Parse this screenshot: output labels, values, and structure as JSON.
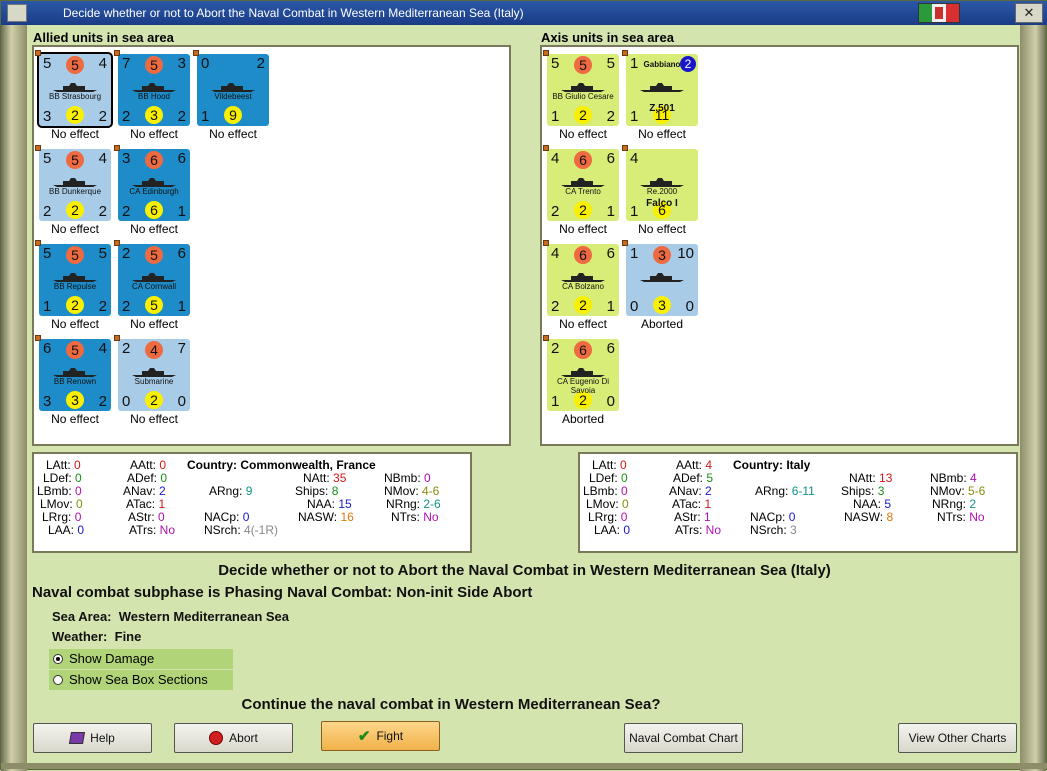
{
  "window": {
    "title": "Decide whether or not to Abort the Naval Combat in Western Mediterranean Sea (Italy)"
  },
  "allied": {
    "heading": "Allied units in sea area",
    "units": [
      {
        "tl": "5",
        "tc": "5",
        "tr": "4",
        "name": "BB Strasbourg",
        "bl": "3",
        "bc": "2",
        "br": "2",
        "status": "No effect",
        "color": "#a8cce8"
      },
      {
        "tl": "7",
        "tc": "5",
        "tr": "3",
        "name": "BB Hood",
        "bl": "2",
        "bc": "3",
        "br": "2",
        "status": "No effect",
        "color": "#1e8cc8"
      },
      {
        "tl": "0",
        "tc": "",
        "tr": "2",
        "name": "Vildebeest",
        "bl": "1",
        "bc": "9",
        "br": "",
        "status": "No effect",
        "color": "#1e8cc8"
      },
      {
        "tl": "5",
        "tc": "5",
        "tr": "4",
        "name": "BB Dunkerque",
        "bl": "2",
        "bc": "2",
        "br": "2",
        "status": "No effect",
        "color": "#a8cce8"
      },
      {
        "tl": "3",
        "tc": "6",
        "tr": "6",
        "name": "CA Edinburgh",
        "bl": "2",
        "bc": "6",
        "br": "1",
        "status": "No effect",
        "color": "#1e8cc8"
      },
      {
        "tl": "5",
        "tc": "5",
        "tr": "5",
        "name": "BB Repulse",
        "bl": "1",
        "bc": "2",
        "br": "2",
        "status": "No effect",
        "color": "#1e8cc8"
      },
      {
        "tl": "2",
        "tc": "5",
        "tr": "6",
        "name": "CA Cornwall",
        "bl": "2",
        "bc": "5",
        "br": "1",
        "status": "No effect",
        "color": "#1e8cc8"
      },
      {
        "tl": "6",
        "tc": "5",
        "tr": "4",
        "name": "BB Renown",
        "bl": "3",
        "bc": "3",
        "br": "2",
        "status": "No effect",
        "color": "#1e8cc8"
      },
      {
        "tl": "2",
        "tc": "4",
        "tr": "7",
        "name": "Submarine",
        "bl": "0",
        "bc": "2",
        "br": "0",
        "status": "No effect",
        "color": "#a8cce8"
      }
    ]
  },
  "axis": {
    "heading": "Axis units in sea area",
    "units": [
      {
        "tl": "5",
        "tc": "5",
        "tr": "5",
        "name": "BB Giulio Cesare",
        "bl": "1",
        "bc": "2",
        "br": "2",
        "status": "No effect",
        "color": "#d8ec78"
      },
      {
        "tl": "1",
        "tc": "",
        "tr": "",
        "name": "Gabbiano",
        "badge": "2",
        "bl": "1",
        "bc": "11",
        "br": "",
        "sub": "Z.501",
        "status": "No effect",
        "color": "#d8ec78"
      },
      {
        "tl": "4",
        "tc": "6",
        "tr": "6",
        "name": "CA Trento",
        "bl": "2",
        "bc": "2",
        "br": "1",
        "status": "No effect",
        "color": "#d8ec78"
      },
      {
        "tl": "4",
        "tc": "",
        "tr": "",
        "name": "Re.2000",
        "sub": "Falco I",
        "bl": "1",
        "bc": "6",
        "br": "",
        "status": "No effect",
        "color": "#d8ec78"
      },
      {
        "tl": "4",
        "tc": "6",
        "tr": "6",
        "name": "CA Bolzano",
        "bl": "2",
        "bc": "2",
        "br": "1",
        "status": "No effect",
        "color": "#d8ec78"
      },
      {
        "tl": "1",
        "tc": "3",
        "tr": "10",
        "name": "",
        "bl": "0",
        "bc": "3",
        "br": "0",
        "status": "Aborted",
        "color": "#a8cce8"
      },
      {
        "tl": "2",
        "tc": "6",
        "tr": "6",
        "name": "CA Eugenio Di Savoia",
        "bl": "1",
        "bc": "2",
        "br": "0",
        "status": "Aborted",
        "color": "#d8ec78"
      }
    ]
  },
  "allied_stats": {
    "country_label": "Country:",
    "country": "Commonwealth, France",
    "LAtt": "0",
    "LDef": "0",
    "LBmb": "0",
    "LMov": "0",
    "LRrg": "0",
    "LAA": "0",
    "AAtt": "0",
    "ADef": "0",
    "ANav": "2",
    "ATac": "1",
    "AStr": "0",
    "ATrs": "No",
    "ARng": "9",
    "NACp": "0",
    "NSrch": "4(-1R)",
    "NAtt": "35",
    "Ships": "8",
    "NAA": "15",
    "NASW": "16",
    "NBmb": "0",
    "NMov": "4-6",
    "NRng": "2-6",
    "NTrs": "No"
  },
  "axis_stats": {
    "country_label": "Country:",
    "country": "Italy",
    "LAtt": "0",
    "LDef": "0",
    "LBmb": "0",
    "LMov": "0",
    "LRrg": "0",
    "LAA": "0",
    "AAtt": "4",
    "ADef": "5",
    "ANav": "2",
    "ATac": "1",
    "AStr": "1",
    "ATrs": "No",
    "ARng": "6-11",
    "NACp": "0",
    "NSrch": "3",
    "NAtt": "13",
    "Ships": "3",
    "NAA": "5",
    "NASW": "8",
    "NBmb": "4",
    "NMov": "5-6",
    "NRng": "2",
    "NTrs": "No"
  },
  "main": {
    "heading": "Decide whether or not to Abort the Naval Combat in Western Mediterranean Sea (Italy)",
    "subphase": "Naval combat subphase is Phasing Naval Combat: Non-init Side Abort",
    "sea_area_label": "Sea Area:",
    "sea_area": "Western Mediterranean Sea",
    "weather_label": "Weather:",
    "weather": "Fine",
    "show_damage": "Show Damage",
    "show_sea_box": "Show Sea Box Sections",
    "question": "Continue the naval combat in Western Mediterranean Sea?"
  },
  "buttons": {
    "help": "Help",
    "abort": "Abort",
    "fight": "Fight",
    "naval_chart": "Naval Combat Chart",
    "other_charts": "View Other Charts"
  },
  "colors": {
    "red": "#d01818",
    "green": "#189018",
    "blue": "#1818c8",
    "teal": "#10908a",
    "magenta": "#b010b0",
    "orange": "#e07810",
    "olive": "#8a8a10",
    "gray": "#888888"
  }
}
